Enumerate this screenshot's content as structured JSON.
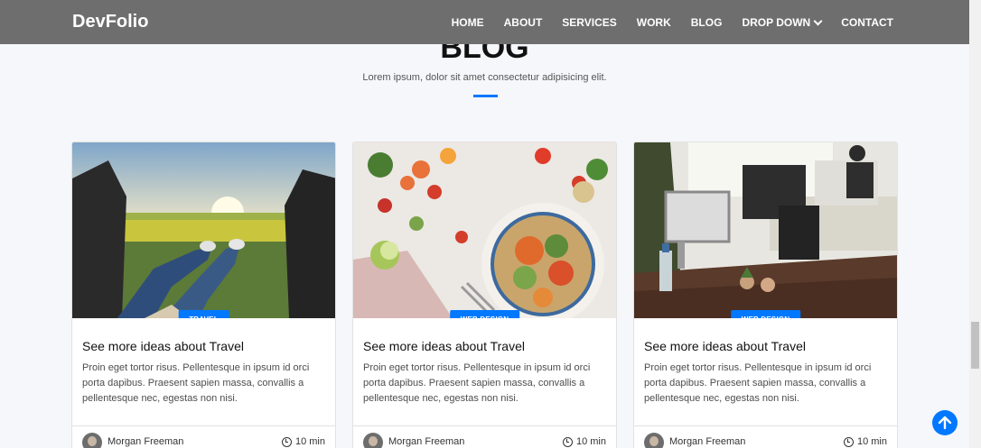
{
  "nav": {
    "brand": "DevFolio",
    "items": [
      "HOME",
      "ABOUT",
      "SERVICES",
      "WORK",
      "BLOG",
      "DROP DOWN",
      "CONTACT"
    ]
  },
  "section": {
    "title": "BLOG",
    "subtitle": "Lorem ipsum, dolor sit amet consectetur adipisicing elit."
  },
  "cards": [
    {
      "category": "TRAVEL",
      "title": "See more ideas about Travel",
      "text": "Proin eget tortor risus. Pellentesque in ipsum id orci porta dapibus. Praesent sapien massa, convallis a pellentesque nec, egestas non nisi.",
      "author": "Morgan Freeman",
      "time": "10 min"
    },
    {
      "category": "WEB DESIGN",
      "title": "See more ideas about Travel",
      "text": "Proin eget tortor risus. Pellentesque in ipsum id orci porta dapibus. Praesent sapien massa, convallis a pellentesque nec, egestas non nisi.",
      "author": "Morgan Freeman",
      "time": "10 min"
    },
    {
      "category": "WEB DESIGN",
      "title": "See more ideas about Travel",
      "text": "Proin eget tortor risus. Pellentesque in ipsum id orci porta dapibus. Praesent sapien massa, convallis a pellentesque nec, egestas non nisi.",
      "author": "Morgan Freeman",
      "time": "10 min"
    }
  ],
  "colors": {
    "accent": "#0078ff",
    "navbar": "#6e6e6e"
  }
}
